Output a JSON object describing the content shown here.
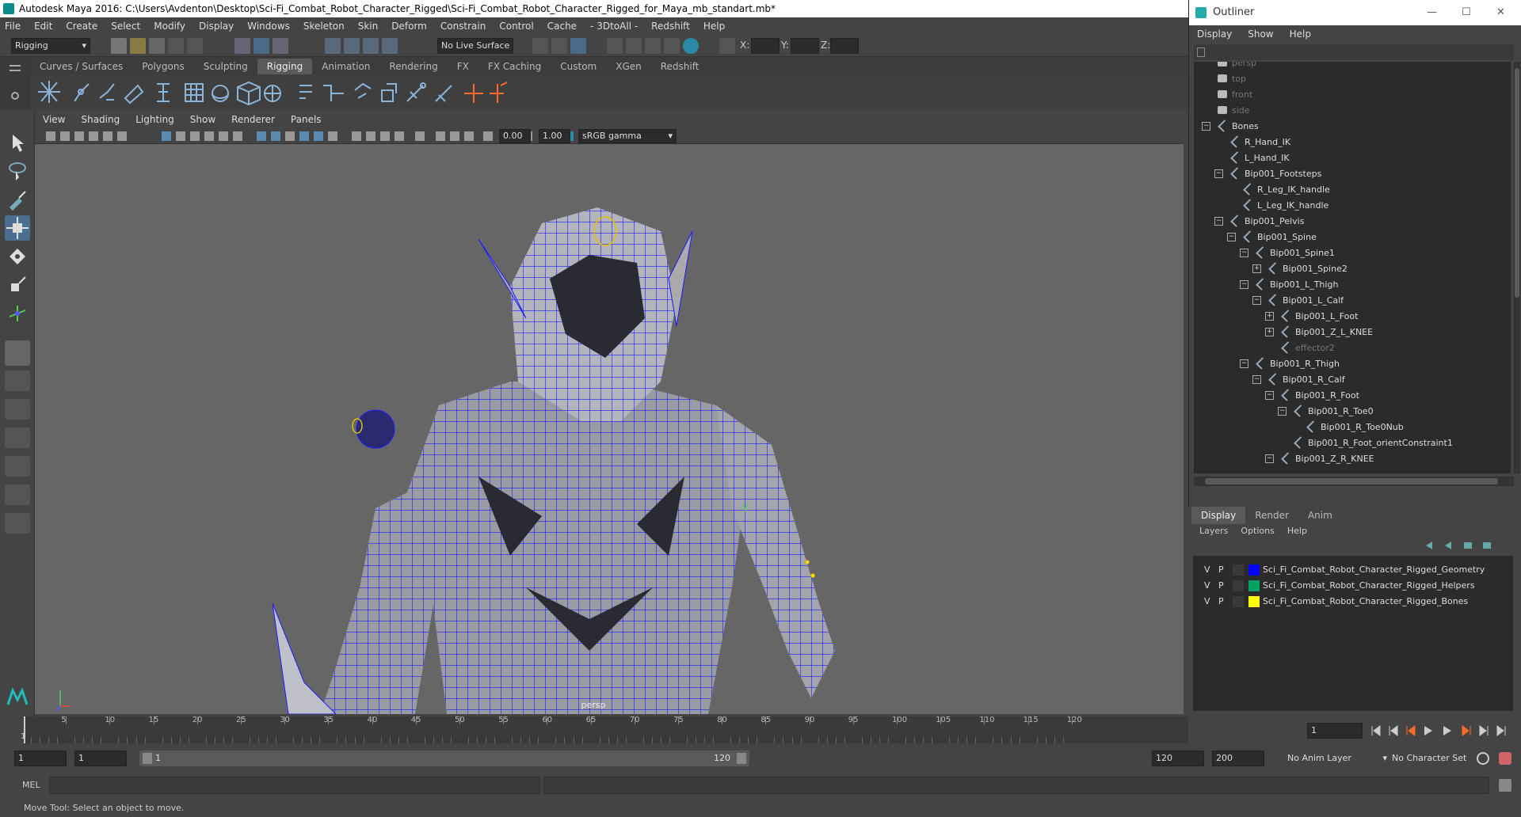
{
  "window": {
    "title": "Autodesk Maya 2016: C:\\Users\\Avdenton\\Desktop\\Sci-Fi_Combat_Robot_Character_Rigged\\Sci-Fi_Combat_Robot_Character_Rigged_for_Maya_mb_standart.mb*"
  },
  "menubar": [
    "File",
    "Edit",
    "Create",
    "Select",
    "Modify",
    "Display",
    "Windows",
    "Skeleton",
    "Skin",
    "Deform",
    "Constrain",
    "Control",
    "Cache",
    "- 3DtoAll -",
    "Redshift",
    "Help"
  ],
  "statusline": {
    "mode": "Rigging",
    "live_surface": "No Live Surface",
    "x_label": "X:",
    "y_label": "Y:",
    "z_label": "Z:"
  },
  "shelf_tabs": [
    {
      "label": "Curves / Surfaces"
    },
    {
      "label": "Polygons"
    },
    {
      "label": "Sculpting"
    },
    {
      "label": "Rigging",
      "active": true
    },
    {
      "label": "Animation"
    },
    {
      "label": "Rendering"
    },
    {
      "label": "FX"
    },
    {
      "label": "FX Caching"
    },
    {
      "label": "Custom"
    },
    {
      "label": "XGen"
    },
    {
      "label": "Redshift"
    }
  ],
  "panel_menu": [
    "View",
    "Shading",
    "Lighting",
    "Show",
    "Renderer",
    "Panels"
  ],
  "panel_toolbar": {
    "exposure": "0.00",
    "gamma": "1.00",
    "colorspace": "sRGB gamma"
  },
  "viewport": {
    "camera_label": "persp",
    "axis_y": "y"
  },
  "timeline": {
    "ticks": [
      "5",
      "10",
      "15",
      "20",
      "25",
      "30",
      "35",
      "40",
      "45",
      "50",
      "55",
      "60",
      "65",
      "70",
      "75",
      "80",
      "85",
      "90",
      "95",
      "100",
      "105",
      "110",
      "115",
      "120"
    ],
    "start_marker": "1",
    "current_frame": "1"
  },
  "range": {
    "start": "1",
    "inner_start": "1",
    "slider_start": "1",
    "slider_end": "120",
    "end": "120",
    "outer_end": "200",
    "anim_layer": "No Anim Layer",
    "char_set": "No Character Set"
  },
  "cmdline": {
    "label": "MEL"
  },
  "helpline": {
    "text": "Move Tool: Select an object to move."
  },
  "outliner": {
    "title": "Outliner",
    "menu": [
      "Display",
      "Show",
      "Help"
    ],
    "items": [
      {
        "label": "persp",
        "indent": 0,
        "dim": true,
        "cam": true
      },
      {
        "label": "top",
        "indent": 0,
        "dim": true,
        "cam": true
      },
      {
        "label": "front",
        "indent": 0,
        "dim": true,
        "cam": true
      },
      {
        "label": "side",
        "indent": 0,
        "dim": true,
        "cam": true
      },
      {
        "label": "Bones",
        "indent": 0,
        "exp": "−"
      },
      {
        "label": "R_Hand_IK",
        "indent": 1
      },
      {
        "label": "L_Hand_IK",
        "indent": 1
      },
      {
        "label": "Bip001_Footsteps",
        "indent": 1,
        "exp": "−"
      },
      {
        "label": "R_Leg_IK_handle",
        "indent": 2
      },
      {
        "label": "L_Leg_IK_handle",
        "indent": 2
      },
      {
        "label": "Bip001_Pelvis",
        "indent": 1,
        "exp": "−"
      },
      {
        "label": "Bip001_Spine",
        "indent": 2,
        "exp": "−"
      },
      {
        "label": "Bip001_Spine1",
        "indent": 3,
        "exp": "−"
      },
      {
        "label": "Bip001_Spine2",
        "indent": 4,
        "exp": "+"
      },
      {
        "label": "Bip001_L_Thigh",
        "indent": 3,
        "exp": "−"
      },
      {
        "label": "Bip001_L_Calf",
        "indent": 4,
        "exp": "−"
      },
      {
        "label": "Bip001_L_Foot",
        "indent": 5,
        "exp": "+"
      },
      {
        "label": "Bip001_Z_L_KNEE",
        "indent": 5,
        "exp": "+"
      },
      {
        "label": "effector2",
        "indent": 5,
        "dim": true
      },
      {
        "label": "Bip001_R_Thigh",
        "indent": 3,
        "exp": "−"
      },
      {
        "label": "Bip001_R_Calf",
        "indent": 4,
        "exp": "−"
      },
      {
        "label": "Bip001_R_Foot",
        "indent": 5,
        "exp": "−"
      },
      {
        "label": "Bip001_R_Toe0",
        "indent": 6,
        "exp": "−"
      },
      {
        "label": "Bip001_R_Toe0Nub",
        "indent": 7
      },
      {
        "label": "Bip001_R_Foot_orientConstraint1",
        "indent": 6
      },
      {
        "label": "Bip001_Z_R_KNEE",
        "indent": 5,
        "exp": "−"
      }
    ]
  },
  "layer_editor": {
    "tabs": [
      {
        "label": "Display",
        "active": true
      },
      {
        "label": "Render"
      },
      {
        "label": "Anim"
      }
    ],
    "menu": [
      "Layers",
      "Options",
      "Help"
    ],
    "layers": [
      {
        "v": "V",
        "p": "P",
        "color": "#0000ff",
        "name": "Sci_Fi_Combat_Robot_Character_Rigged_Geometry"
      },
      {
        "v": "V",
        "p": "P",
        "color": "#00a060",
        "name": "Sci_Fi_Combat_Robot_Character_Rigged_Helpers"
      },
      {
        "v": "V",
        "p": "P",
        "color": "#ffff00",
        "name": "Sci_Fi_Combat_Robot_Character_Rigged_Bones"
      }
    ]
  }
}
